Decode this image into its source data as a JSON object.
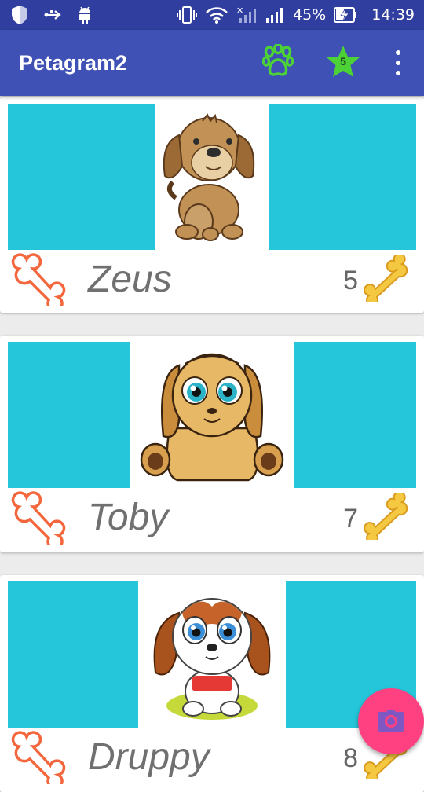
{
  "status_bar": {
    "battery_percent": "45%",
    "time": "14:39"
  },
  "app_bar": {
    "title": "Petagram2",
    "favorites_count": "5",
    "icons": [
      "paw-icon",
      "star-icon",
      "more-vert-icon"
    ]
  },
  "pets": [
    {
      "name": "Zeus",
      "likes": "5"
    },
    {
      "name": "Toby",
      "likes": "7"
    },
    {
      "name": "Druppy",
      "likes": "8"
    }
  ],
  "fab": {
    "icon": "camera-icon"
  },
  "colors": {
    "status_bar": "#303f9f",
    "app_bar": "#3f51b5",
    "photo_bg": "#26c6da",
    "accent": "#ff4081",
    "paw": "#4cd137"
  }
}
